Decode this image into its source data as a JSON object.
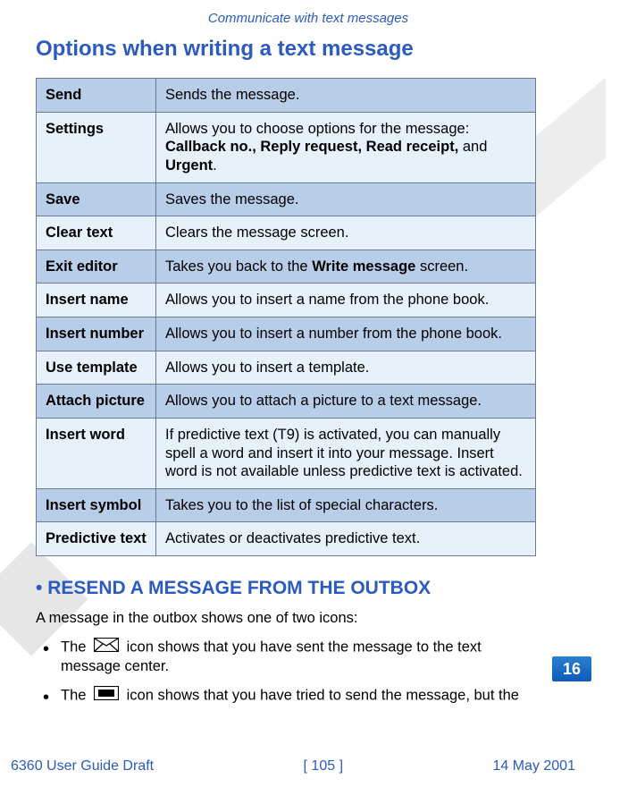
{
  "header": "Communicate with text messages",
  "section_title": "Options when writing a text message",
  "table": {
    "rows": [
      {
        "label": "Send",
        "desc_plain": "Sends the message."
      },
      {
        "label": "Settings",
        "desc_prefix": "Allows you to choose options for the message:",
        "desc_bold_list": "Callback no., Reply request, Read receipt,",
        "desc_and": " and ",
        "desc_bold_last": "Urgent",
        "desc_suffix": "."
      },
      {
        "label": "Save",
        "desc_plain": "Saves the message."
      },
      {
        "label": "Clear text",
        "desc_plain": "Clears the message screen."
      },
      {
        "label": "Exit editor",
        "desc_prefix": "Takes you back to the ",
        "desc_bold": "Write message",
        "desc_suffix": " screen."
      },
      {
        "label": "Insert name",
        "desc_plain": "Allows you to insert a name from the phone book."
      },
      {
        "label": "Insert number",
        "desc_plain": "Allows you to insert a number from the phone book."
      },
      {
        "label": "Use template",
        "desc_plain": "Allows you to insert a template."
      },
      {
        "label": "Attach picture",
        "desc_plain": "Allows you to attach a picture to a text message."
      },
      {
        "label": "Insert word",
        "desc_plain": "If predictive text (T9) is activated, you can manually spell a word and insert it into your message. Insert word is not available unless predictive text is activated."
      },
      {
        "label": "Insert symbol",
        "desc_plain": "Takes you to the list of special characters."
      },
      {
        "label": "Predictive text",
        "desc_plain": "Activates or deactivates predictive text."
      }
    ]
  },
  "subheading_bullet": "•",
  "subheading": " RESEND A MESSAGE FROM THE OUTBOX",
  "outbox_intro": "A message in the outbox shows one of two icons:",
  "bullets": {
    "b1_pre": "The ",
    "b1_post": " icon shows that you have sent the message to the text message center.",
    "b2_pre": "The ",
    "b2_post": " icon shows that you have tried to send the message, but the"
  },
  "page_tab": "16",
  "footer": {
    "left": "6360 User Guide Draft",
    "center": "[ 105 ]",
    "right": "14 May 2001"
  },
  "colors": {
    "blue": "#2b5bbf",
    "row_dark": "#b8cde8",
    "row_light": "#e8f0fa"
  }
}
